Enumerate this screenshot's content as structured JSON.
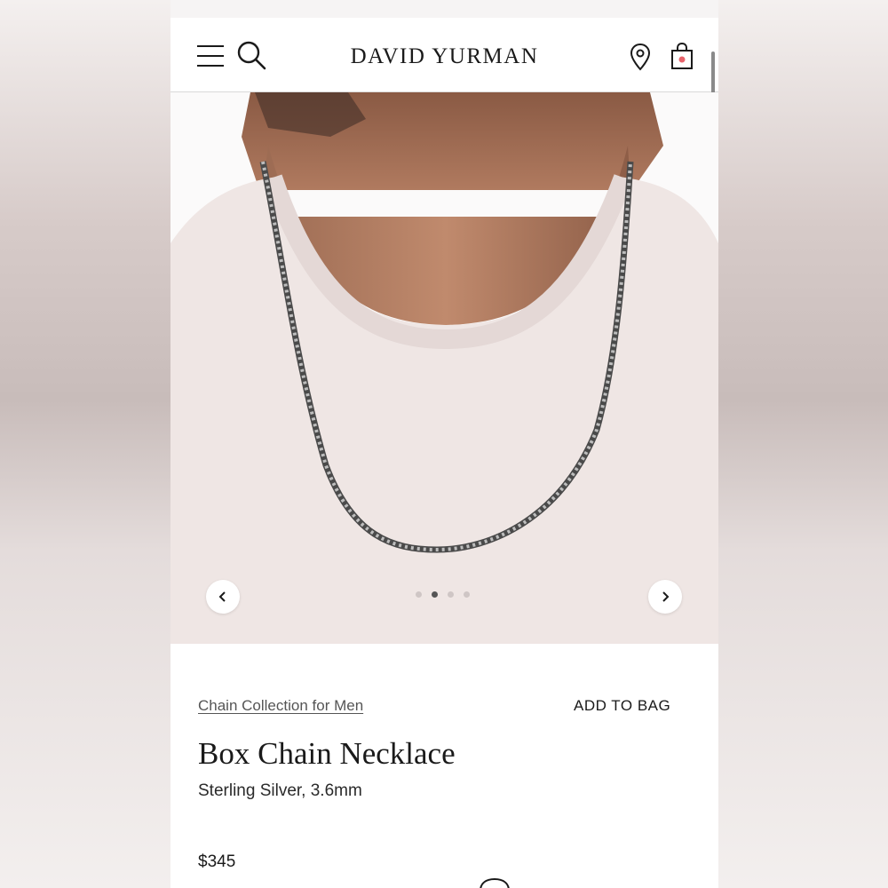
{
  "header": {
    "brand": "DAVID YURMAN",
    "icons": [
      "menu-icon",
      "search-icon",
      "location-pin-icon",
      "shopping-bag-icon"
    ],
    "bag_dot_color": "#e8636b"
  },
  "carousel": {
    "image_subject": "man wearing box chain necklace over cream sweater",
    "dot_count": 4,
    "active_dot": 2
  },
  "product": {
    "collection_link": "Chain Collection for Men",
    "add_to_bag_label": "ADD TO BAG",
    "title": "Box Chain Necklace",
    "subtitle": "Sterling Silver, 3.6mm",
    "price": "$345"
  },
  "colors": {
    "text": "#1a1a1a",
    "link": "#555555",
    "sweater": "#efe6e4"
  }
}
